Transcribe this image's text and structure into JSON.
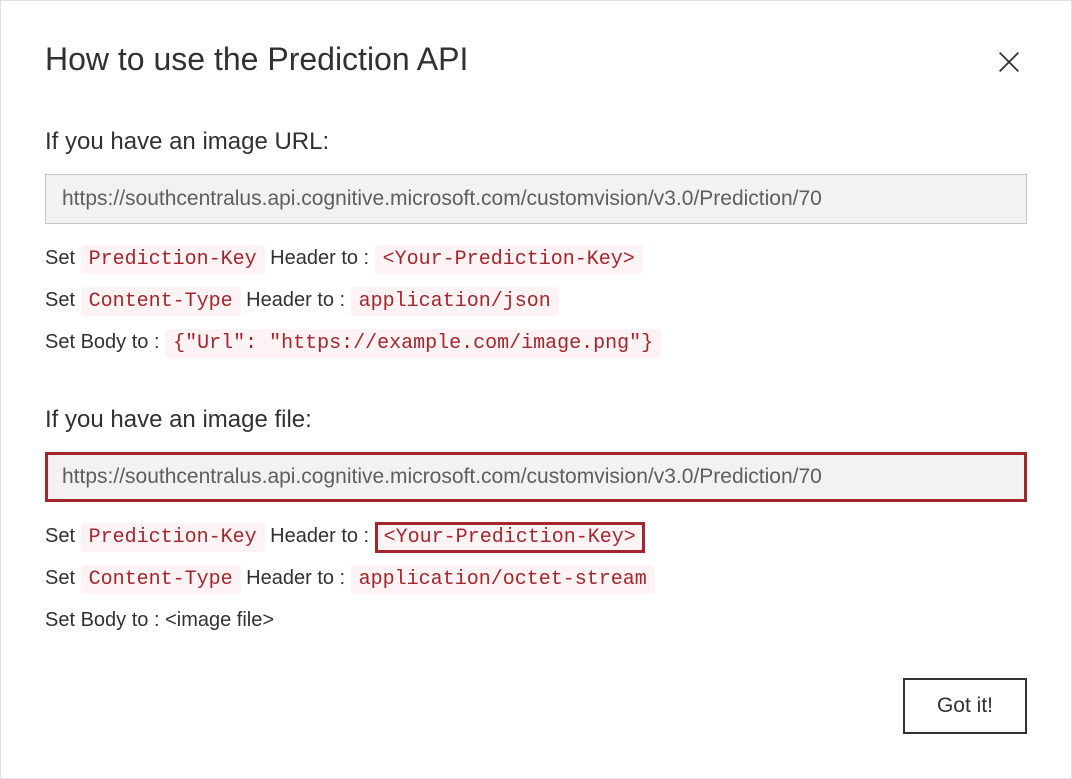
{
  "dialog": {
    "title": "How to use the Prediction API",
    "gotItLabel": "Got it!"
  },
  "section1": {
    "heading": "If you have an image URL:",
    "url": "https://southcentralus.api.cognitive.microsoft.com/customvision/v3.0/Prediction/70",
    "line1": {
      "prefix": "Set ",
      "code1": "Prediction-Key",
      "middle": " Header to : ",
      "code2": "<Your-Prediction-Key>"
    },
    "line2": {
      "prefix": "Set ",
      "code1": "Content-Type",
      "middle": " Header to : ",
      "code2": "application/json"
    },
    "line3": {
      "prefix": "Set Body to : ",
      "code1": "{\"Url\": \"https://example.com/image.png\"}"
    }
  },
  "section2": {
    "heading": "If you have an image file:",
    "url": "https://southcentralus.api.cognitive.microsoft.com/customvision/v3.0/Prediction/70",
    "line1": {
      "prefix": "Set ",
      "code1": "Prediction-Key",
      "middle": " Header to : ",
      "code2": "<Your-Prediction-Key>"
    },
    "line2": {
      "prefix": "Set ",
      "code1": "Content-Type",
      "middle": " Header to : ",
      "code2": "application/octet-stream"
    },
    "line3": {
      "text": "Set Body to : <image file>"
    }
  }
}
